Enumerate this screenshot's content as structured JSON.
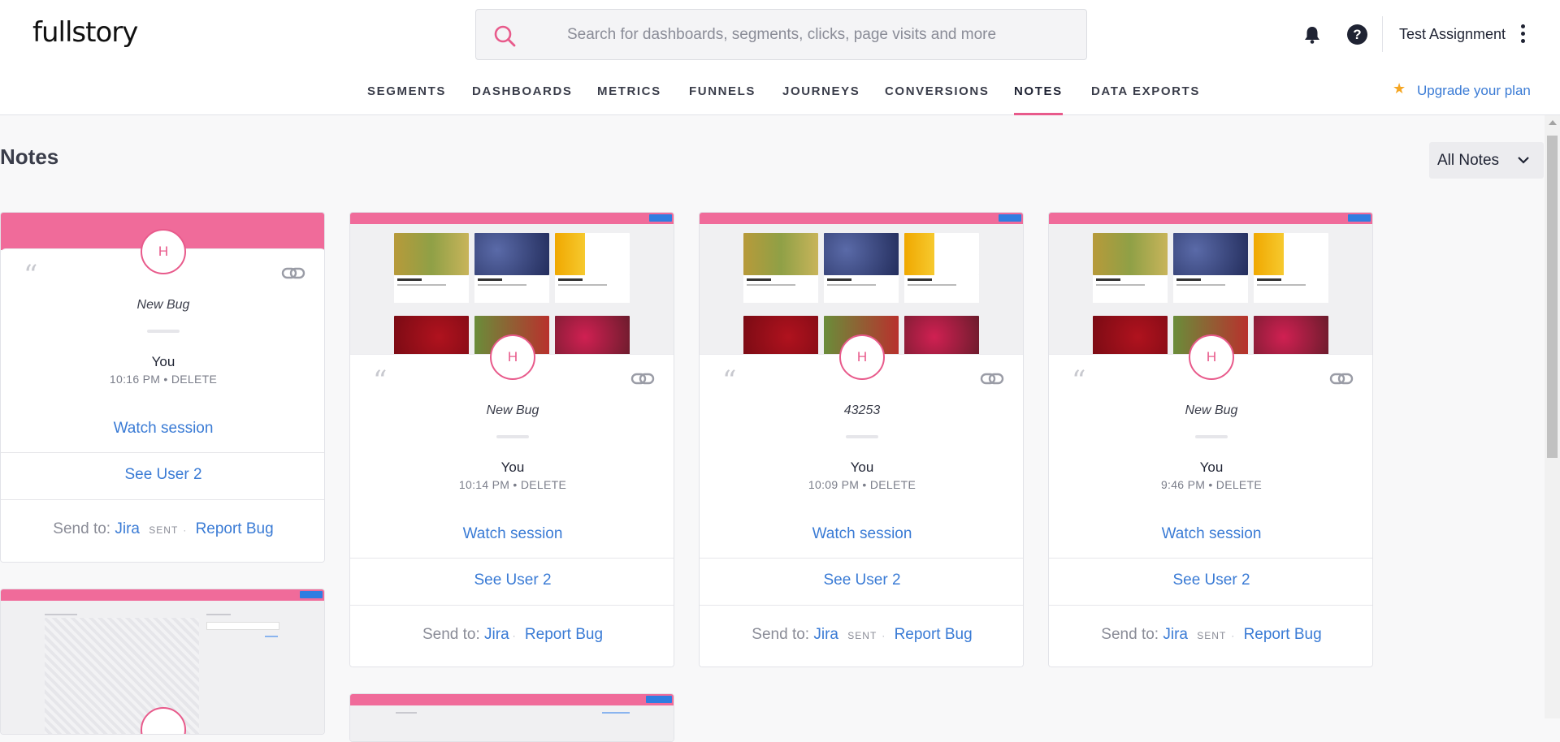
{
  "app": {
    "logo": "fullstory"
  },
  "search": {
    "placeholder": "Search for dashboards, segments, clicks, page visits and more"
  },
  "header": {
    "account_name": "Test Assignment",
    "help_label": "?"
  },
  "nav": {
    "tabs": [
      {
        "label": "SEGMENTS"
      },
      {
        "label": "DASHBOARDS"
      },
      {
        "label": "METRICS"
      },
      {
        "label": "FUNNELS"
      },
      {
        "label": "JOURNEYS"
      },
      {
        "label": "CONVERSIONS"
      },
      {
        "label": "NOTES",
        "active": true
      },
      {
        "label": "DATA EXPORTS"
      }
    ],
    "upgrade_label": "Upgrade your plan"
  },
  "page": {
    "title": "Notes",
    "filter_label": "All Notes"
  },
  "colors": {
    "accent": "#e85a8b",
    "link": "#3a7bd5",
    "star": "#f5a623"
  },
  "notes": [
    {
      "avatar": "H",
      "text": "New Bug",
      "author": "You",
      "time": "10:16 PM",
      "delete_label": "DELETE",
      "watch_label": "Watch session",
      "user_label": "See User 2",
      "send_to_label": "Send to:",
      "jira_label": "Jira",
      "sent_label": "SENT",
      "report_label": "Report Bug"
    },
    {
      "avatar": "H",
      "text": "New Bug",
      "author": "You",
      "time": "10:14 PM",
      "delete_label": "DELETE",
      "watch_label": "Watch session",
      "user_label": "See User 2",
      "send_to_label": "Send to:",
      "jira_label": "Jira",
      "report_label": "Report Bug"
    },
    {
      "avatar": "H",
      "text": "43253",
      "author": "You",
      "time": "10:09 PM",
      "delete_label": "DELETE",
      "watch_label": "Watch session",
      "user_label": "See User 2",
      "send_to_label": "Send to:",
      "jira_label": "Jira",
      "sent_label": "SENT",
      "report_label": "Report Bug"
    },
    {
      "avatar": "H",
      "text": "New Bug",
      "author": "You",
      "time": "9:46 PM",
      "delete_label": "DELETE",
      "watch_label": "Watch session",
      "user_label": "See User 2",
      "send_to_label": "Send to:",
      "jira_label": "Jira",
      "sent_label": "SENT",
      "report_label": "Report Bug"
    }
  ]
}
